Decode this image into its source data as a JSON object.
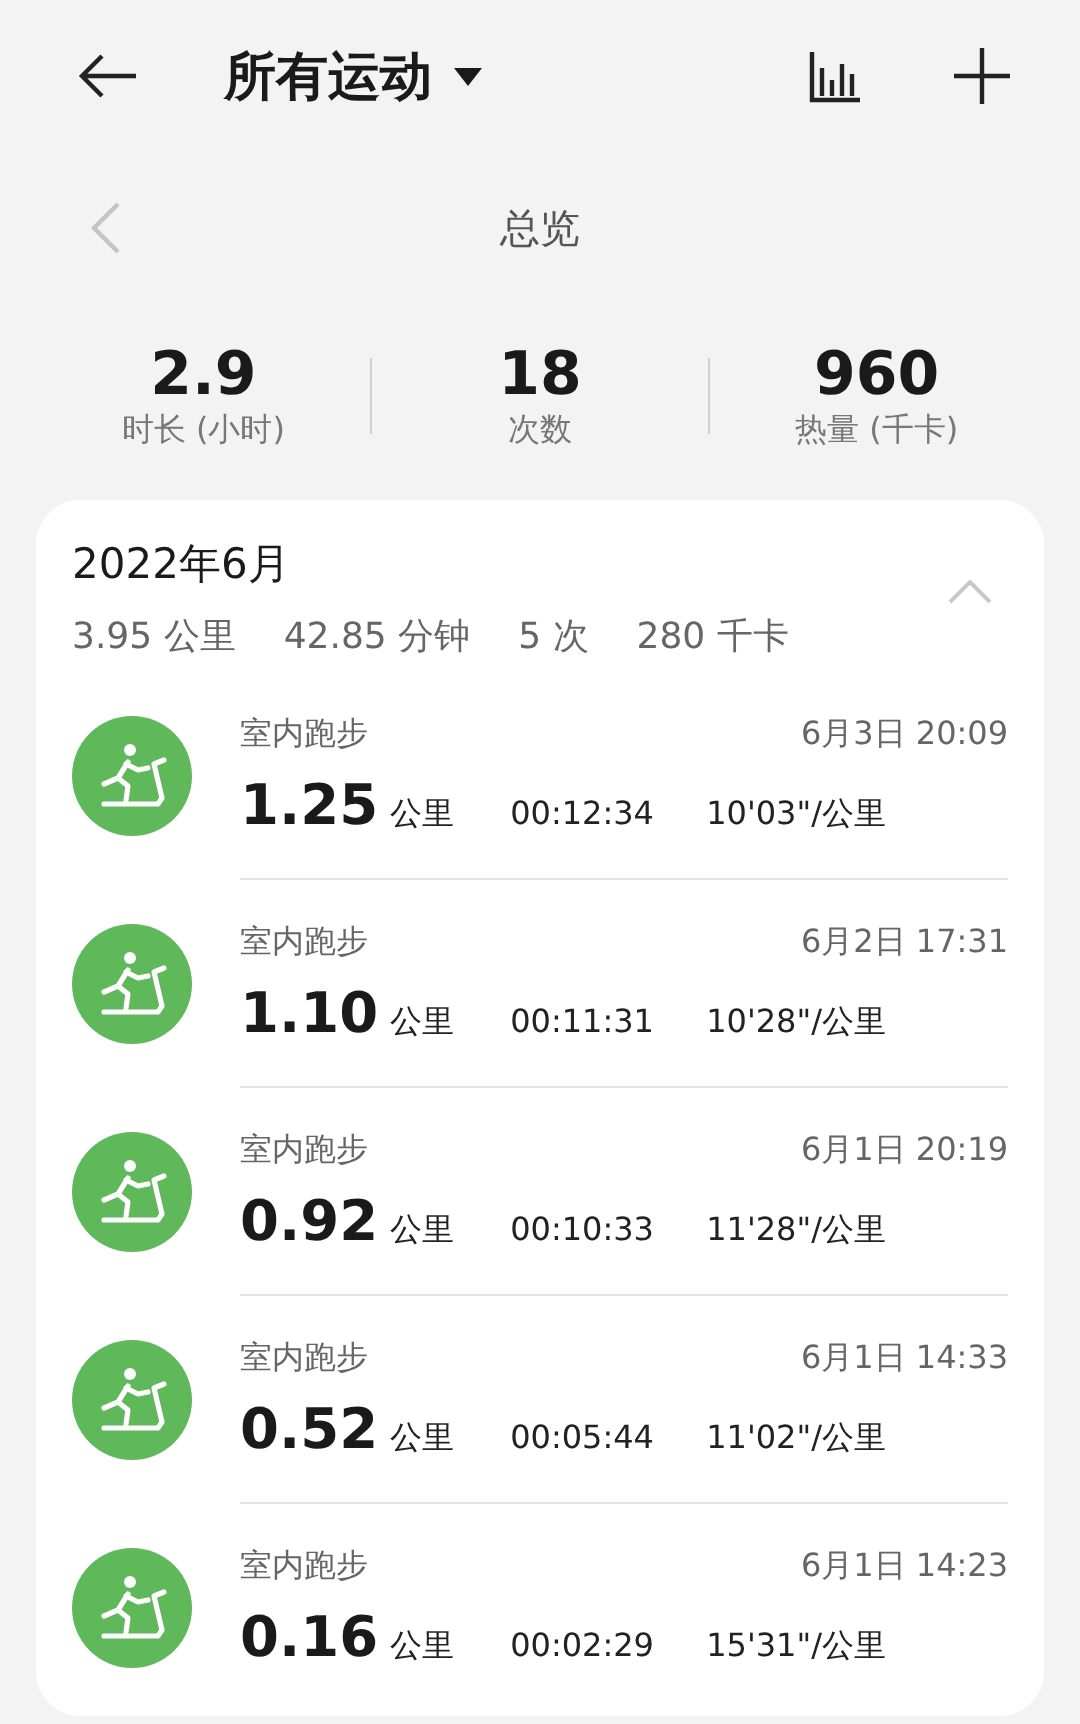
{
  "header": {
    "title": "所有运动"
  },
  "overview": {
    "title": "总览",
    "previous_disabled": true,
    "stats": [
      {
        "value": "2.9",
        "label": "时长 (小时)"
      },
      {
        "value": "18",
        "label": "次数"
      },
      {
        "value": "960",
        "label": "热量 (千卡)"
      }
    ]
  },
  "month": {
    "title": "2022年6月",
    "expanded": true,
    "summary": [
      "3.95 公里",
      "42.85 分钟",
      "5 次",
      "280 千卡"
    ],
    "records": [
      {
        "type": "室内跑步",
        "time": "6月3日 20:09",
        "distance": "1.25",
        "unit": "公里",
        "duration": "00:12:34",
        "pace": "10'03\"/公里"
      },
      {
        "type": "室内跑步",
        "time": "6月2日 17:31",
        "distance": "1.10",
        "unit": "公里",
        "duration": "00:11:31",
        "pace": "10'28\"/公里"
      },
      {
        "type": "室内跑步",
        "time": "6月1日 20:19",
        "distance": "0.92",
        "unit": "公里",
        "duration": "00:10:33",
        "pace": "11'28\"/公里"
      },
      {
        "type": "室内跑步",
        "time": "6月1日 14:33",
        "distance": "0.52",
        "unit": "公里",
        "duration": "00:05:44",
        "pace": "11'02\"/公里"
      },
      {
        "type": "室内跑步",
        "time": "6月1日 14:23",
        "distance": "0.16",
        "unit": "公里",
        "duration": "00:02:29",
        "pace": "15'31\"/公里"
      }
    ]
  }
}
